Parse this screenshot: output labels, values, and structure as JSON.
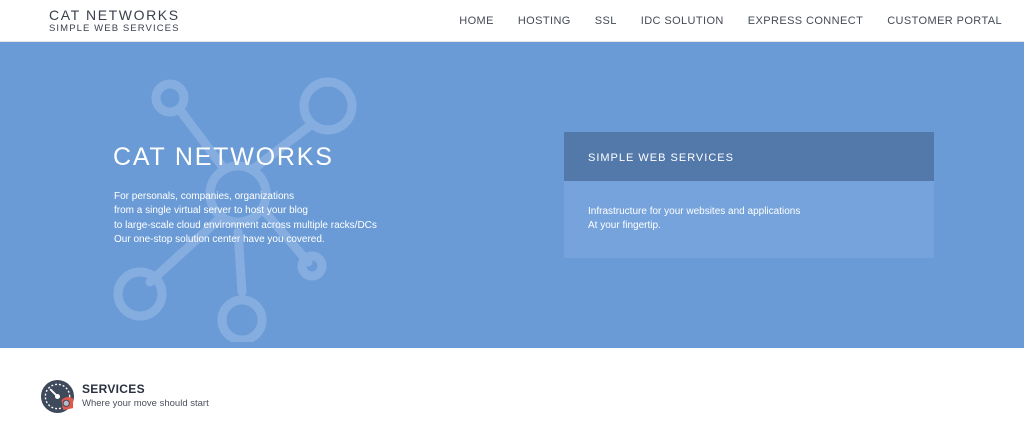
{
  "header": {
    "brand_title": "CAT NETWORKS",
    "brand_subtitle": "SIMPLE WEB SERVICES",
    "nav": [
      "HOME",
      "HOSTING",
      "SSL",
      "IDC SOLUTION",
      "EXPRESS CONNECT",
      "CUSTOMER PORTAL"
    ]
  },
  "hero": {
    "title": "CAT NETWORKS",
    "description": [
      "For personals, companies, organizations",
      "from a single virtual server to host your blog",
      "to large-scale cloud environment across multiple racks/DCs",
      "Our one-stop solution center have you covered."
    ],
    "background_color": "#6a9bd6",
    "decoration_icon": "network-nodes-icon"
  },
  "panel": {
    "heading": "SIMPLE WEB SERVICES",
    "body": [
      "Infrastructure for your websites and applications",
      "At your fingertip."
    ],
    "heading_color": "#5379ab",
    "body_color": "#76a3db"
  },
  "services": {
    "title": "SERVICES",
    "subtitle": "Where your move should start",
    "icon": "gauge-gear-icon"
  }
}
